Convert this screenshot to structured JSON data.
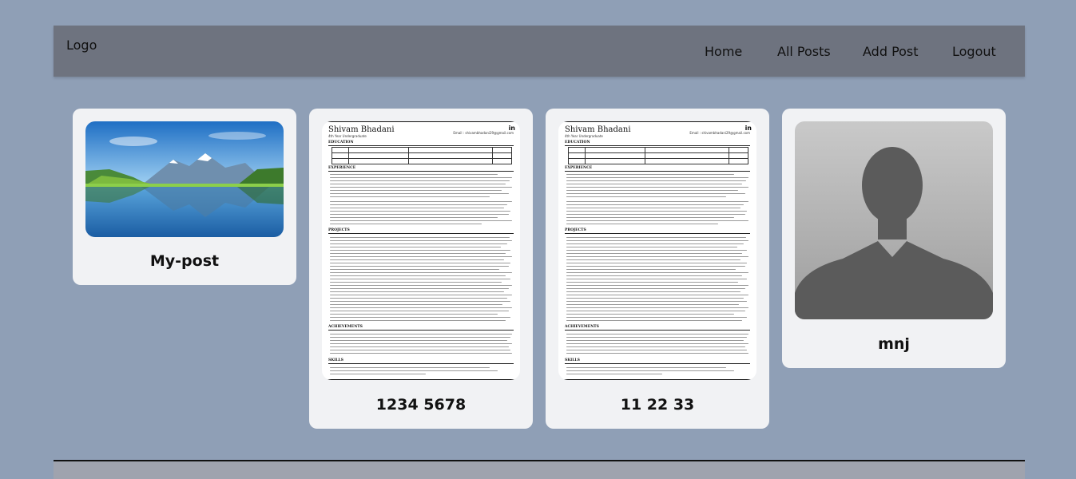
{
  "nav": {
    "logo": "Logo",
    "links": [
      "Home",
      "All Posts",
      "Add Post",
      "Logout"
    ]
  },
  "posts": [
    {
      "title": "My-post",
      "image": "mountain-lake-landscape"
    },
    {
      "title": "1234 5678",
      "image": "resume-document"
    },
    {
      "title": "11 22 33",
      "image": "resume-document"
    },
    {
      "title": "mnj",
      "image": "default-avatar-silhouette"
    }
  ],
  "resume": {
    "name": "Shivam Bhadani",
    "subtitle": "4th Year Undergraduate",
    "email": "Email : shivambhadani29@gmail.com",
    "sections": [
      "EDUCATION",
      "EXPERIENCE",
      "PROJECTS",
      "ACHIEVEMENTS",
      "SKILLS"
    ],
    "icon": "linkedin-icon"
  },
  "colors": {
    "page_bg": "#8f9fb6",
    "navbar_bg": "#6e737f",
    "card_bg": "#f1f2f4"
  }
}
